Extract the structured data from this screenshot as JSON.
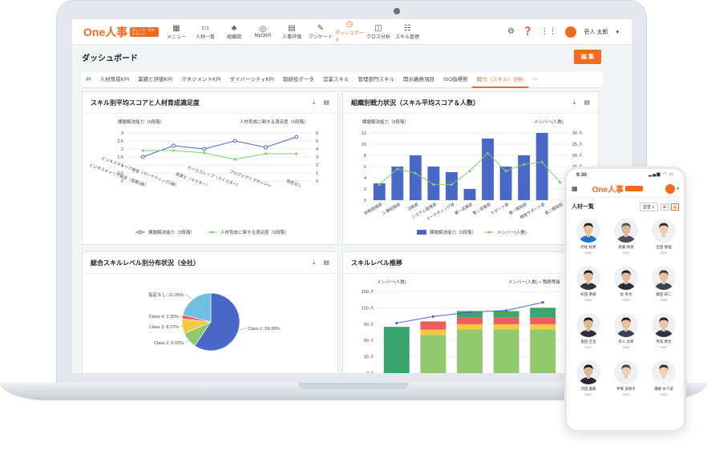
{
  "app": {
    "logo": "One人事",
    "logo_tag": "タレント マネジメント",
    "user_name": "壱人 太郎"
  },
  "nav": [
    {
      "icon": "grid-icon",
      "glyph": "▦",
      "label": "メニュー"
    },
    {
      "icon": "id-card-icon",
      "glyph": "▭",
      "label": "人材一覧"
    },
    {
      "icon": "org-chart-icon",
      "glyph": "♣",
      "label": "組織図"
    },
    {
      "icon": "target-icon",
      "glyph": "◎",
      "label": "MyOKR"
    },
    {
      "icon": "document-icon",
      "glyph": "▤",
      "label": "人事評価"
    },
    {
      "icon": "edit-icon",
      "glyph": "✎",
      "label": "アンケート"
    },
    {
      "icon": "clock-icon",
      "glyph": "◷",
      "label": "ダッシュボード",
      "active": true
    },
    {
      "icon": "window-icon",
      "glyph": "◫",
      "label": "クロス分析"
    },
    {
      "icon": "people-icon",
      "glyph": "☷",
      "label": "スキル管理"
    }
  ],
  "page": {
    "title": "ダッシュボード",
    "edit_label": "編 集"
  },
  "tabs": [
    "PI",
    "人材育成KPI",
    "業績と評価KPI",
    "マネジメントKPI",
    "ダイバーシティKPI",
    "取締役データ",
    "営業スキル",
    "管理部門スキル",
    "開示義務項目",
    "ISO指標例",
    "戦力（スキル）分析",
    "⋯"
  ],
  "active_tab": 10,
  "cards": {
    "line": {
      "title": "スキル別平均スコアと人材育成満足度"
    },
    "bar": {
      "title": "組織別戦力状況（スキル平均スコア＆人数）"
    },
    "pie": {
      "title": "総合スキルレベル別分布状況（全社）"
    },
    "stack": {
      "title": "スキルレベル推移"
    }
  },
  "chart_data": [
    {
      "type": "line",
      "title": "スキル別平均スコアと人材育成満足度",
      "left_axis_label": "課題解決能力（5段階）",
      "right_axis_label": "人材育成に関する満足度（5段階）",
      "categories": [
        "ビジネスキャリア検定（営業2級）",
        "ビジネスキャリア検定（マーケティング2級）",
        "営業士（マスター）",
        "セールスレップ（マイスター）",
        "プロジェクトマネージャ",
        "指定なし"
      ],
      "series": [
        {
          "name": "課題解決能力（5段階）",
          "axis": "left",
          "color": "#4a68c8",
          "values": [
            1.5,
            2.2,
            2.0,
            2.5,
            2.1,
            2.75
          ]
        },
        {
          "name": "人材育成に関する満足度（5段階）",
          "axis": "right",
          "color": "#7dcf6e",
          "values": [
            3.8,
            3.8,
            3.5,
            2.7,
            3.4,
            3.4
          ]
        }
      ],
      "left_ylim": [
        0,
        3
      ],
      "left_ticks": [
        "0",
        "0.5",
        "1",
        "1.5",
        "2",
        "2.5",
        "3"
      ],
      "right_ylim": [
        0,
        6
      ],
      "right_ticks": [
        "0",
        "1",
        "2",
        "3",
        "4",
        "5",
        "6"
      ]
    },
    {
      "type": "bar",
      "title": "組織別戦力状況（スキル平均スコア＆人数）",
      "left_axis_label": "課題解決能力（5段階）",
      "right_axis_label": "メンバー(人数)",
      "categories": [
        "財務経理部",
        "人事総務部",
        "法務部",
        "システム管理部",
        "マーケティング部",
        "第一営業部",
        "第二営業部",
        "サポート部",
        "第一開発部",
        "開発サポート部",
        "第二開発部"
      ],
      "series": [
        {
          "name": "課題解決能力（5段階）",
          "type": "bar",
          "axis": "left",
          "color": "#4a68c8",
          "values": [
            3,
            6,
            8,
            6,
            5,
            2,
            11,
            6,
            8,
            12,
            0
          ]
        },
        {
          "name": "メンバー(人数)",
          "type": "line",
          "axis": "right",
          "color": "#7dcf6e",
          "values": [
            7,
            14,
            12,
            7,
            7,
            13,
            21,
            13,
            16,
            17,
            8
          ]
        }
      ],
      "left_ylim": [
        0,
        12
      ],
      "left_ticks": [
        "0",
        "2",
        "4",
        "6",
        "8",
        "10",
        "12"
      ],
      "right_ylim": [
        0,
        30
      ],
      "right_ticks": [
        "0 人",
        "5 人",
        "10 人",
        "15 人",
        "20 人",
        "25 人",
        "30 人"
      ]
    },
    {
      "type": "pie",
      "title": "総合スキルレベル別分布状況（全社）",
      "slices": [
        {
          "label": "Class 1: 59.39%",
          "value": 59.39,
          "color": "#4a68c8"
        },
        {
          "label": "Class 2: 9.02%",
          "value": 9.02,
          "color": "#93c96e"
        },
        {
          "label": "Class 3: 8.27%",
          "value": 8.27,
          "color": "#f5c842"
        },
        {
          "label": "Class 4: 2.25%",
          "value": 2.25,
          "color": "#ee5d5d"
        },
        {
          "label": "指定なし: 21.05%",
          "value": 21.05,
          "color": "#6fbfe0"
        }
      ]
    },
    {
      "type": "bar",
      "title": "スキルレベル推移",
      "left_axis_label": "メンバー(人数)",
      "right_axis_label": "メンバー(人数) × 職務等級",
      "left_ylim": [
        0,
        150
      ],
      "left_ticks": [
        "0 人",
        "30 人",
        "60 人",
        "90 人",
        "120 人",
        "150 人"
      ],
      "stacked": true,
      "columns": [
        [
          {
            "v": 85,
            "c": "#3aa56c"
          }
        ],
        [
          {
            "v": 70,
            "c": "#93c96e"
          },
          {
            "v": 10,
            "c": "#f5c842"
          },
          {
            "v": 15,
            "c": "#ee5d5d"
          }
        ],
        [
          {
            "v": 80,
            "c": "#93c96e"
          },
          {
            "v": 10,
            "c": "#f5c842"
          },
          {
            "v": 12,
            "c": "#ee5d5d"
          },
          {
            "v": 12,
            "c": "#3aa56c"
          }
        ],
        [
          {
            "v": 80,
            "c": "#93c96e"
          },
          {
            "v": 10,
            "c": "#f5c842"
          },
          {
            "v": 12,
            "c": "#ee5d5d"
          },
          {
            "v": 12,
            "c": "#3aa56c"
          }
        ],
        [
          {
            "v": 80,
            "c": "#93c96e"
          },
          {
            "v": 10,
            "c": "#f5c842"
          },
          {
            "v": 12,
            "c": "#ee5d5d"
          },
          {
            "v": 18,
            "c": "#3aa56c"
          }
        ]
      ],
      "line": {
        "color": "#4a68c8",
        "values": [
          92,
          104,
          112,
          115,
          130
        ]
      }
    }
  ],
  "phone": {
    "time": "9:30",
    "logo": "One人事",
    "title": "人材一覧",
    "sort_label": "並替 ∨",
    "people": [
      {
        "name": "壱松 松男",
        "id": "0031",
        "skin": "#e9c19f",
        "hair": "#2a1d14",
        "suit": "#1e73c6"
      },
      {
        "name": "新藤 政男",
        "id": "0032",
        "skin": "#dfb595",
        "hair": "#555555",
        "suit": "#4a4f58"
      },
      {
        "name": "吉田 恵理",
        "id": "0033",
        "skin": "#f0ccb0",
        "hair": "#3a2617",
        "suit": "#f1f1f1"
      },
      {
        "name": "杉田 勇磨",
        "id": "0034",
        "skin": "#e6bb98",
        "hair": "#1d1712",
        "suit": "#2f3645"
      },
      {
        "name": "佐 孝也",
        "id": "0035",
        "skin": "#e3b896",
        "hair": "#241a12",
        "suit": "#2b2f38"
      },
      {
        "name": "藤田 研二",
        "id": "0036",
        "skin": "#e8c0a0",
        "hair": "#3b3b3b",
        "suit": "#3a4456"
      },
      {
        "name": "塩田 圭治",
        "id": "0037",
        "skin": "#e1b592",
        "hair": "#1c1510",
        "suit": "#2a2f38"
      },
      {
        "name": "壱人 太郎",
        "id": "0038",
        "skin": "#e7bf9d",
        "hair": "#2a1e15",
        "suit": "#3b4251"
      },
      {
        "name": "寺島 勇也",
        "id": "0039",
        "skin": "#e9c3a3",
        "hair": "#262020",
        "suit": "#2c3440"
      },
      {
        "name": "沢田 義範",
        "id": "0040",
        "skin": "#e2b794",
        "hair": "#1a1410",
        "suit": "#262b33"
      },
      {
        "name": "伊東 美保子",
        "id": "0041",
        "skin": "#f0cdb0",
        "hair": "#5a3a22",
        "suit": "#efefef"
      },
      {
        "name": "瀬尾 ゆり菜",
        "id": "0042",
        "skin": "#f2cfb3",
        "hair": "#3d2818",
        "suit": "#f4f4f4"
      }
    ]
  },
  "colors": {
    "accent": "#f26b1d",
    "blue": "#4a68c8",
    "green": "#7dcf6e"
  }
}
